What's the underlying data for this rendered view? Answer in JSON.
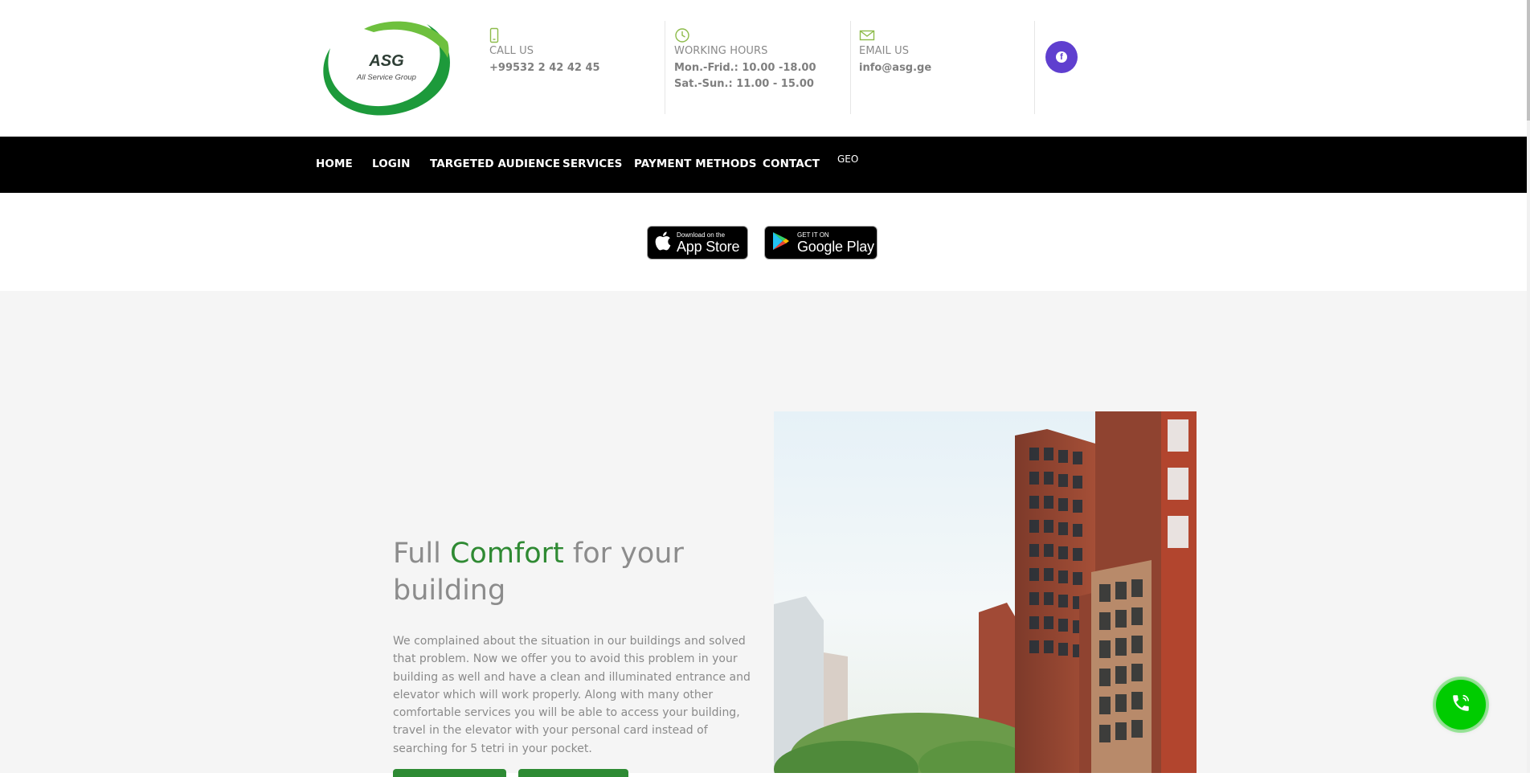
{
  "header": {
    "logo": {
      "title": "ASG",
      "subtitle": "All Service Group"
    },
    "call": {
      "label": "CALL US",
      "value": "+99532 2 42 42 45"
    },
    "hours": {
      "label": "WORKING HOURS",
      "weekdays": "Mon.-Frid.: 10.00 -18.00",
      "weekend": "Sat.-Sun.: 11.00 - 15.00"
    },
    "email": {
      "label": "EMAIL US",
      "value": "info@asg.ge"
    },
    "social_icon": "facebook-icon"
  },
  "nav": {
    "items": [
      {
        "label": "HOME"
      },
      {
        "label": "LOGIN"
      },
      {
        "label": "TARGETED AUDIENCE"
      },
      {
        "label": "SERVICES"
      },
      {
        "label": "PAYMENT METHODS"
      },
      {
        "label": "CONTACT"
      }
    ],
    "language": "GEO"
  },
  "badges": {
    "app_store": {
      "small": "Download on the",
      "big": "App Store"
    },
    "google_play": {
      "small": "GET IT ON",
      "big": "Google Play"
    }
  },
  "hero": {
    "title_pre": "Full ",
    "title_accent": "Comfort",
    "title_post": " for your building",
    "text": "We complained about the situation in our buildings and solved that problem. Now we offer you to avoid this problem in your building as well and have a clean and illuminated entrance and elevator which will work properly. Along with many other comfortable services you will be able to access your building, travel in the elevator with your personal card instead of searching for 5 tetri in your pocket."
  },
  "colors": {
    "brand_green": "#2f8a33",
    "nav_bg": "#000000",
    "facebook_bg": "#5f3fcf",
    "call_button": "#00cc00"
  }
}
